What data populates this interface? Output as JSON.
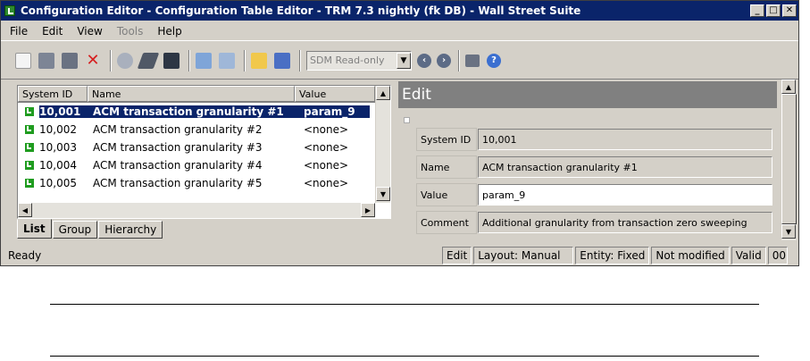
{
  "window": {
    "title": "Configuration Editor - Configuration Table Editor - TRM 7.3 nightly (fk DB) - Wall Street Suite"
  },
  "menu": [
    "File",
    "Edit",
    "View",
    "Tools",
    "Help"
  ],
  "toolbar": {
    "sdm_combo": "SDM Read-only"
  },
  "list": {
    "columns": [
      "System ID",
      "Name",
      "Value"
    ],
    "rows": [
      {
        "id": "10,001",
        "name": "ACM transaction granularity #1",
        "value": "param_9"
      },
      {
        "id": "10,002",
        "name": "ACM transaction granularity #2",
        "value": "<none>"
      },
      {
        "id": "10,003",
        "name": "ACM transaction granularity #3",
        "value": "<none>"
      },
      {
        "id": "10,004",
        "name": "ACM transaction granularity #4",
        "value": "<none>"
      },
      {
        "id": "10,005",
        "name": "ACM transaction granularity #5",
        "value": "<none>"
      }
    ]
  },
  "tabs": [
    "List",
    "Group",
    "Hierarchy"
  ],
  "edit": {
    "header": "Edit",
    "fields": [
      {
        "label": "System ID",
        "value": "10,001"
      },
      {
        "label": "Name",
        "value": "ACM transaction granularity #1"
      },
      {
        "label": "Value",
        "value": "param_9"
      },
      {
        "label": "Comment",
        "value": "Additional granularity from transaction zero sweeping"
      }
    ]
  },
  "status": {
    "message": "Ready",
    "mode": "Edit",
    "layout": "Layout: Manual",
    "entity": "Entity: Fixed",
    "modified": "Not modified",
    "valid": "Valid",
    "extra": "00:"
  }
}
